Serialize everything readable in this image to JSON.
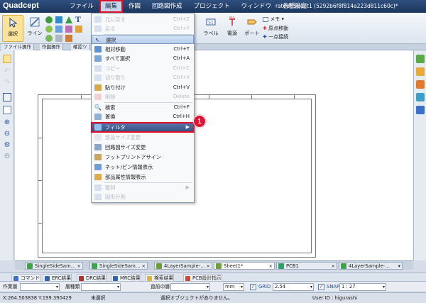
{
  "app": {
    "logo": "Quadcept",
    "document_title": "rated] Sheet1 (5292b6f8f814a223d811c60c)*"
  },
  "menubar": {
    "items": [
      {
        "label": "ファイル"
      },
      {
        "label": "編集",
        "active": true
      },
      {
        "label": "作図"
      },
      {
        "label": "回路図作成"
      },
      {
        "label": "プロジェクト"
      },
      {
        "label": "ウィンドウ"
      },
      {
        "label": "各種設定"
      }
    ]
  },
  "ribbon": {
    "select": "選択",
    "line": "ライン",
    "label": "ラベル",
    "power": "電源",
    "port": "ポート",
    "memo": "メモ",
    "origin_move": "原点移動",
    "one_point_connect": "一点接続"
  },
  "ribbon_tabs": [
    "ファイル操作",
    "作図操作",
    "確認ツ"
  ],
  "edit_menu": {
    "items": [
      {
        "label": "元に戻す",
        "shortcut": "Ctrl+Z",
        "disabled": true
      },
      {
        "label": "戻る",
        "shortcut": "Ctrl+Y",
        "disabled": true
      },
      {
        "label": "選択",
        "shortcut": "",
        "hover": true
      },
      {
        "label": "相対移動",
        "shortcut": "Ctrl+T"
      },
      {
        "label": "すべて選択",
        "shortcut": "Ctrl+A"
      },
      {
        "label": "コピー",
        "shortcut": "Ctrl+C",
        "disabled": true
      },
      {
        "label": "切り取り",
        "shortcut": "Ctrl+X",
        "disabled": true
      },
      {
        "label": "貼り付け",
        "shortcut": "Ctrl+V"
      },
      {
        "label": "削除",
        "shortcut": "Delete",
        "disabled": true
      },
      {
        "label": "検索",
        "shortcut": "Ctrl+F"
      },
      {
        "label": "置換",
        "shortcut": "Ctrl+H"
      },
      {
        "label": "フィルタ",
        "shortcut": "▶",
        "focused": true
      },
      {
        "label": "部品サイズ変更",
        "shortcut": "",
        "disabled": true
      },
      {
        "label": "回路図サイズ変更",
        "shortcut": ""
      },
      {
        "label": "フットプリントアサイン",
        "shortcut": ""
      },
      {
        "label": "ネット/ピン情報表示",
        "shortcut": ""
      },
      {
        "label": "部品属性情報表示",
        "shortcut": ""
      },
      {
        "label": "整列",
        "shortcut": "▶",
        "disabled": true
      },
      {
        "label": "図形分割",
        "shortcut": "",
        "disabled": true
      }
    ],
    "callout_number": "1"
  },
  "doc_tabs": [
    {
      "label": "SingleSideSam…"
    },
    {
      "label": "SingleSideSam…"
    },
    {
      "label": "4LayerSample-…"
    },
    {
      "label": "Sheet1*",
      "active": true
    },
    {
      "label": "PCB1"
    },
    {
      "label": "4LayerSample-…"
    }
  ],
  "panel_tabs": [
    "コマンド",
    "ERC結果",
    "DRC結果",
    "MRC結果",
    "検索結果",
    "PCB設計指示"
  ],
  "property_bar": {
    "layer_label": "作業層",
    "line_type_label": "層種類",
    "prev_layer_label": "直前の層",
    "unit": "mm",
    "grid_label": "GRID",
    "grid_value": "2.54",
    "snap_label": "SNAP",
    "snap_value": "1 : 27"
  },
  "status_bar": {
    "coords": "X:264.503838 Y:199.390429",
    "selection": "未選択",
    "message": "選択オブジェクトがありません。",
    "user": "User ID : higurashi"
  }
}
